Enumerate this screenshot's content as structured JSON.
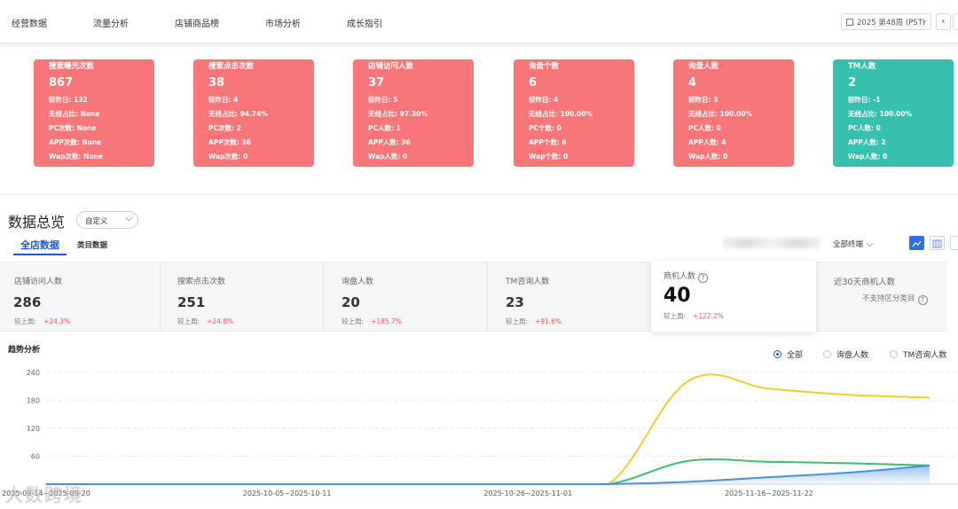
{
  "nav": {
    "tabs": [
      "经营数据",
      "流量分析",
      "店铺商品榜",
      "市场分析",
      "成长指引"
    ],
    "week": "2025 第48周 (PST)"
  },
  "cards": [
    {
      "title": "搜索曝光次数",
      "value": "867",
      "rows": [
        "较昨日: 132",
        "无线占比: None",
        "PC次数: None",
        "APP次数: None",
        "Wap次数: None"
      ],
      "color": "#f87677"
    },
    {
      "title": "搜索点击次数",
      "value": "38",
      "rows": [
        "较昨日: 4",
        "无线占比: 94.74%",
        "PC次数: 2",
        "APP次数: 36",
        "Wap次数: 0"
      ],
      "color": "#f87677"
    },
    {
      "title": "店铺访问人数",
      "value": "37",
      "rows": [
        "较昨日: 5",
        "无线占比: 97.30%",
        "PC人数: 1",
        "APP人数: 36",
        "Wap人数: 0"
      ],
      "color": "#f87677"
    },
    {
      "title": "询盘个数",
      "value": "6",
      "rows": [
        "较昨日: 4",
        "无线占比: 100.00%",
        "PC个数: 0",
        "APP个数: 6",
        "Wap个数: 0"
      ],
      "color": "#f87677"
    },
    {
      "title": "询盘人数",
      "value": "4",
      "rows": [
        "较昨日: 3",
        "无线占比: 100.00%",
        "PC人数: 0",
        "APP人数: 4",
        "Wap人数: 0"
      ],
      "color": "#f87677"
    },
    {
      "title": "TM人数",
      "value": "2",
      "rows": [
        "较昨日: -1",
        "无线占比: 100.00%",
        "PC人数: 0",
        "APP人数: 2",
        "Wap人数: 0"
      ],
      "color": "#36c0b0"
    }
  ],
  "overview": {
    "title": "数据总览",
    "range": "自定义",
    "tab_active": "全店数据",
    "tab_other": "类目数据",
    "terminal": "全部终端"
  },
  "stats": [
    {
      "label": "店铺访问人数",
      "value": "286",
      "compare": "较上周:",
      "change": "+24.3%"
    },
    {
      "label": "搜索点击次数",
      "value": "251",
      "compare": "较上周:",
      "change": "+24.8%"
    },
    {
      "label": "询盘人数",
      "value": "20",
      "compare": "较上周:",
      "change": "+185.7%"
    },
    {
      "label": "TM咨询人数",
      "value": "23",
      "compare": "较上周:",
      "change": "+91.6%"
    },
    {
      "label": "商机人数",
      "value": "40",
      "compare": "较上周:",
      "change": "+122.2%"
    },
    {
      "label": "近30天商机人数",
      "note": "不支持区分类目"
    }
  ],
  "trend": {
    "title": "趋势分析",
    "legend": [
      "全部",
      "询盘人数",
      "TM咨询人数"
    ],
    "watermark": "大数跨境"
  },
  "chart_data": {
    "type": "line",
    "ylim": [
      0,
      240
    ],
    "yticks": [
      60,
      120,
      180,
      240
    ],
    "xtick_labels": [
      "2025-09-14~2025-09-20",
      "2025-10-05~2025-10-11",
      "2025-10-26~2025-11-01",
      "2025-11-16~2025-11-22"
    ],
    "x_index": [
      0,
      1,
      2,
      3,
      4,
      5,
      6,
      7,
      8,
      9,
      10,
      11
    ],
    "series": [
      {
        "color": "#f2cd2e",
        "values": [
          0,
          0,
          0,
          0,
          0,
          0,
          0,
          0,
          222,
          205,
          192,
          186
        ]
      },
      {
        "color": "#3ac06d",
        "values": [
          0,
          0,
          0,
          0,
          0,
          0,
          0,
          0,
          50,
          48,
          45,
          40
        ]
      },
      {
        "color": "#4a90e2",
        "values": [
          0,
          0,
          0,
          0,
          0,
          0,
          0,
          0,
          5,
          15,
          25,
          40
        ]
      }
    ]
  }
}
